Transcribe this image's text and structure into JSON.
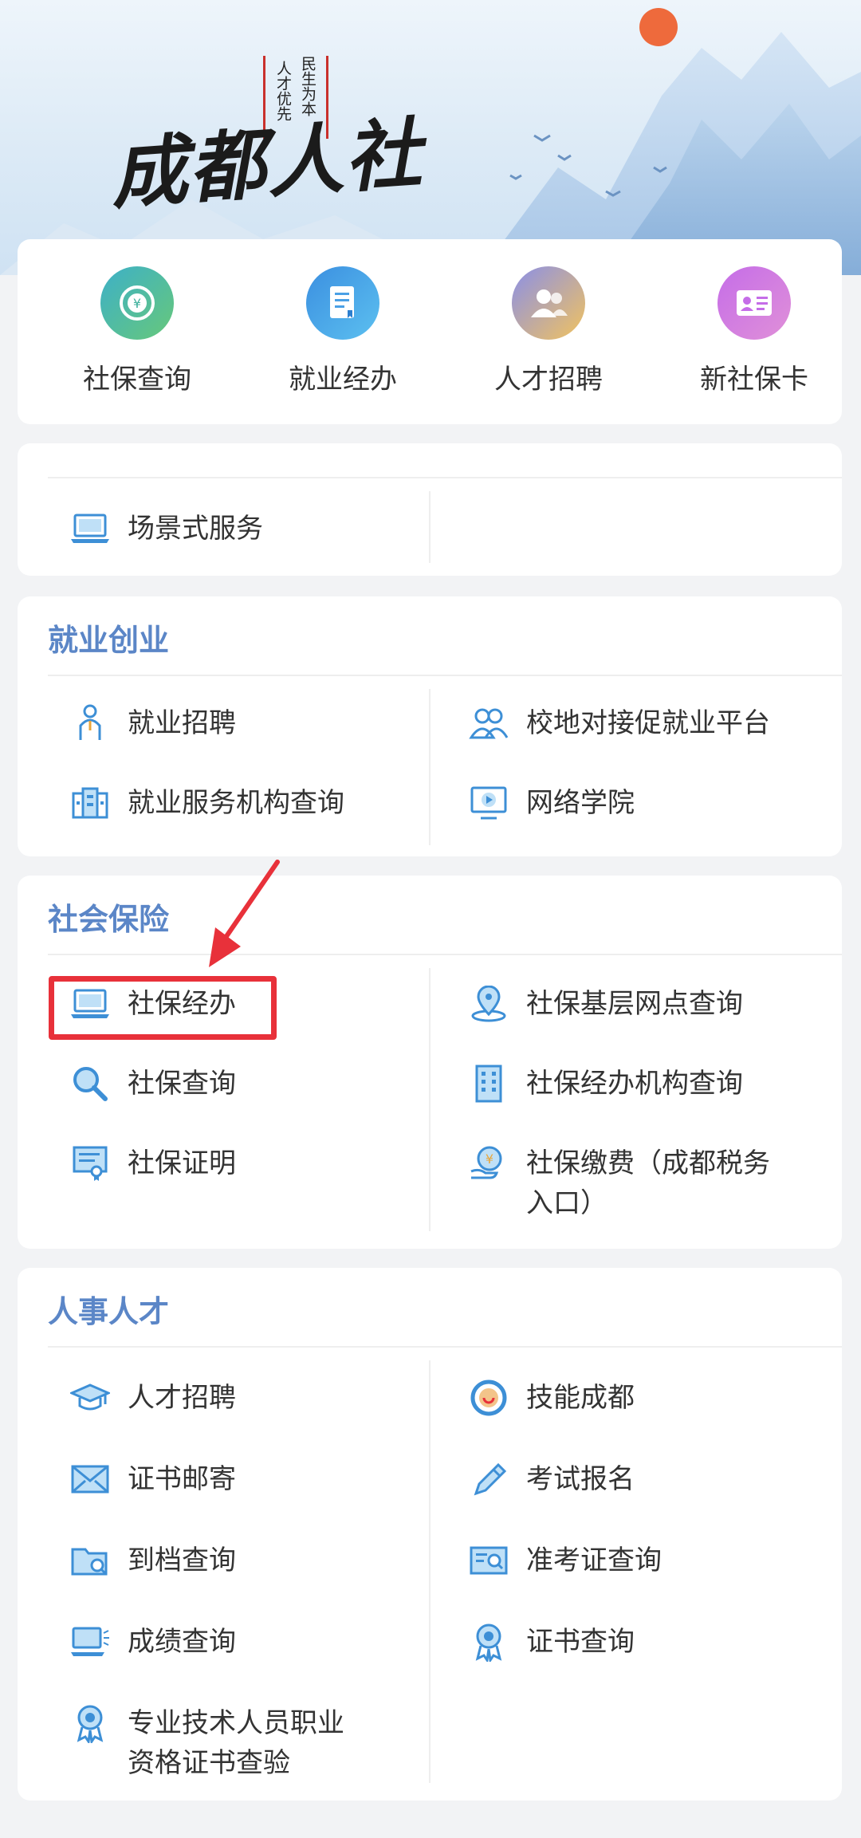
{
  "banner": {
    "logo_text": "成都人社",
    "motto_1": "民生为本",
    "motto_2": "人才优先"
  },
  "quick_nav": [
    {
      "label": "社保查询",
      "icon": "yuan-coin-icon",
      "color": "#52b98a"
    },
    {
      "label": "就业经办",
      "icon": "document-icon",
      "color": "#4aa0e6"
    },
    {
      "label": "人才招聘",
      "icon": "people-icon",
      "color": "#e9b96a"
    },
    {
      "label": "新社保卡",
      "icon": "id-card-icon",
      "color": "#b473e6"
    }
  ],
  "scene": {
    "label": "场景式服务"
  },
  "sections": {
    "employment": {
      "title": "就业创业",
      "items": [
        "就业招聘",
        "校地对接促就业平台",
        "就业服务机构查询",
        "网络学院"
      ]
    },
    "insurance": {
      "title": "社会保险",
      "items": [
        "社保经办",
        "社保基层网点查询",
        "社保查询",
        "社保经办机构查询",
        "社保证明",
        "社保缴费（成都税务",
        "入口）"
      ]
    },
    "talent": {
      "title": "人事人才",
      "items": [
        "人才招聘",
        "技能成都",
        "证书邮寄",
        "考试报名",
        "到档查询",
        "准考证查询",
        "成绩查询",
        "证书查询",
        "专业技术人员职业",
        "资格证书查验"
      ]
    }
  },
  "accent_color": "#5b86c7",
  "highlight_color": "#e8313a"
}
